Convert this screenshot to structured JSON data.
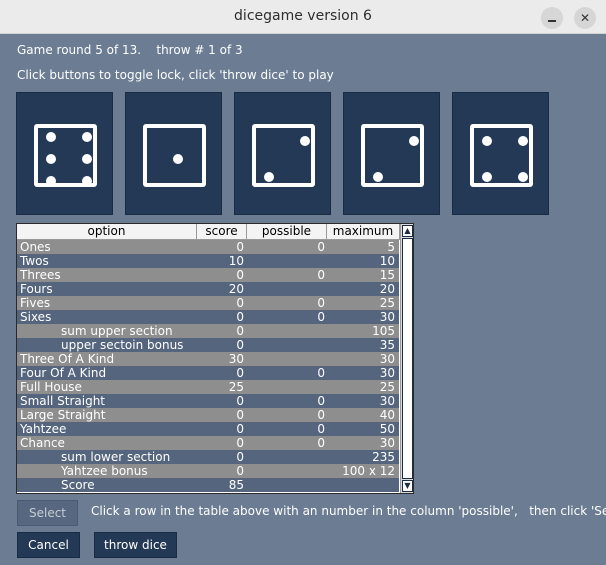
{
  "window": {
    "title": "dicegame version 6",
    "minimize_glyph": "",
    "close_glyph": "✕"
  },
  "status": {
    "round_line": "Game round 5 of 13.    throw # 1 of 3",
    "instruction": "Click buttons to toggle lock, click 'throw dice' to play"
  },
  "dice": [
    {
      "value": 6,
      "icon": "die-six-icon"
    },
    {
      "value": 1,
      "icon": "die-one-icon"
    },
    {
      "value": 2,
      "icon": "die-two-icon"
    },
    {
      "value": 2,
      "icon": "die-two-icon"
    },
    {
      "value": 4,
      "icon": "die-four-icon"
    }
  ],
  "table": {
    "headers": {
      "option": "option",
      "score": "score",
      "possible": "possible",
      "maximum": "maximum"
    },
    "rows": [
      {
        "option": "Ones",
        "score": "0",
        "possible": "0",
        "maximum": "5"
      },
      {
        "option": "Twos",
        "score": "10",
        "possible": "",
        "maximum": "10"
      },
      {
        "option": "Threes",
        "score": "0",
        "possible": "0",
        "maximum": "15"
      },
      {
        "option": "Fours",
        "score": "20",
        "possible": "",
        "maximum": "20"
      },
      {
        "option": "Fives",
        "score": "0",
        "possible": "0",
        "maximum": "25"
      },
      {
        "option": "Sixes",
        "score": "0",
        "possible": "0",
        "maximum": "30"
      },
      {
        "option": "sum upper section",
        "score": "0",
        "possible": "",
        "maximum": "105",
        "indent": true
      },
      {
        "option": "upper sectoin bonus",
        "score": "0",
        "possible": "",
        "maximum": "35",
        "indent": true
      },
      {
        "option": "Three Of A Kind",
        "score": "30",
        "possible": "",
        "maximum": "30"
      },
      {
        "option": "Four Of A Kind",
        "score": "0",
        "possible": "0",
        "maximum": "30"
      },
      {
        "option": "Full House",
        "score": "25",
        "possible": "",
        "maximum": "25"
      },
      {
        "option": "Small Straight",
        "score": "0",
        "possible": "0",
        "maximum": "30"
      },
      {
        "option": "Large Straight",
        "score": "0",
        "possible": "0",
        "maximum": "40"
      },
      {
        "option": "Yahtzee",
        "score": "0",
        "possible": "0",
        "maximum": "50"
      },
      {
        "option": "Chance",
        "score": "0",
        "possible": "0",
        "maximum": "30"
      },
      {
        "option": "sum lower section",
        "score": "0",
        "possible": "",
        "maximum": "235",
        "indent": true
      },
      {
        "option": "Yahtzee bonus",
        "score": "0",
        "possible": "",
        "maximum": "100 x 12",
        "indent": true
      },
      {
        "option": "Score",
        "score": "85",
        "possible": "",
        "maximum": "",
        "indent": true
      }
    ]
  },
  "scrollbar": {
    "up_glyph": "▲",
    "down_glyph": "▼"
  },
  "buttons": {
    "select": "Select",
    "cancel": "Cancel",
    "throw": "throw dice"
  },
  "hint": "Click a row in the table above with an number in the column 'possible',   then click 'Select'",
  "colors": {
    "background": "#6b7c93",
    "die_bg": "#243955",
    "row_odd": "#8e8e8e",
    "row_even": "#55657d"
  }
}
